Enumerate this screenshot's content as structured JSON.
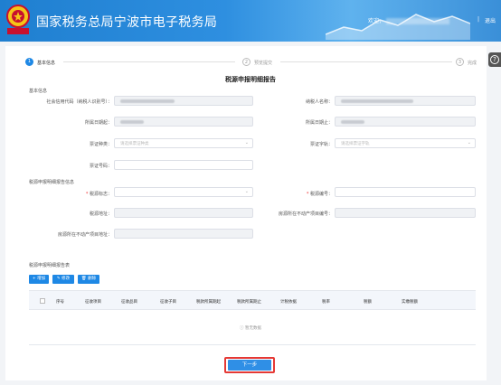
{
  "header": {
    "site_title": "国家税务总局宁波市电子税务局",
    "welcome": "欢迎，",
    "separator": "|",
    "logout": "退出"
  },
  "help": {
    "icon": "question-icon",
    "glyph": "?"
  },
  "steps": [
    {
      "num": "1",
      "label": "基本信息",
      "active": true
    },
    {
      "num": "2",
      "label": "预览提交",
      "active": false
    },
    {
      "num": "3",
      "label": "完成",
      "active": false
    }
  ],
  "form": {
    "title": "税源申报明细报告",
    "section_basic": "基本信息",
    "taxpayer_id_label": "社会信用代码（纳税人识别号）：",
    "taxpayer_name_label": "纳税人名称：",
    "belong_start_label": "所属日期起：",
    "belong_end_label": "所属日期止：",
    "cert_type_label": "票证种类：",
    "cert_type_placeholder": "请选择票证种类",
    "cert_char_label": "票证字轨：",
    "cert_char_placeholder": "请选择票证字轨",
    "cert_no_label": "票证号码：",
    "section_detail": "税源申报明细报告信息",
    "source_flag_label": "税源标志：",
    "source_no_label": "税源编号：",
    "source_address_label": "税源地址：",
    "property_no_label": "房源所在不动产项目编号：",
    "property_address_label": "房源所在不动产项目地址："
  },
  "detail_table": {
    "title": "税源申报明细报告表",
    "add_label": "+ 增加",
    "modify_label": "修改",
    "delete_label": "删除",
    "columns": [
      "序号",
      "征收项目",
      "征收品目",
      "征收子目",
      "税款所属期起",
      "税款所属期止",
      "计税依据",
      "税率",
      "税额",
      "实缴税额"
    ],
    "empty_text": "暂无数据"
  },
  "footer": {
    "next_label": "下一步"
  },
  "colors": {
    "primary": "#1e88e5",
    "header": "#2e8fe0",
    "highlight": "#e53935"
  }
}
